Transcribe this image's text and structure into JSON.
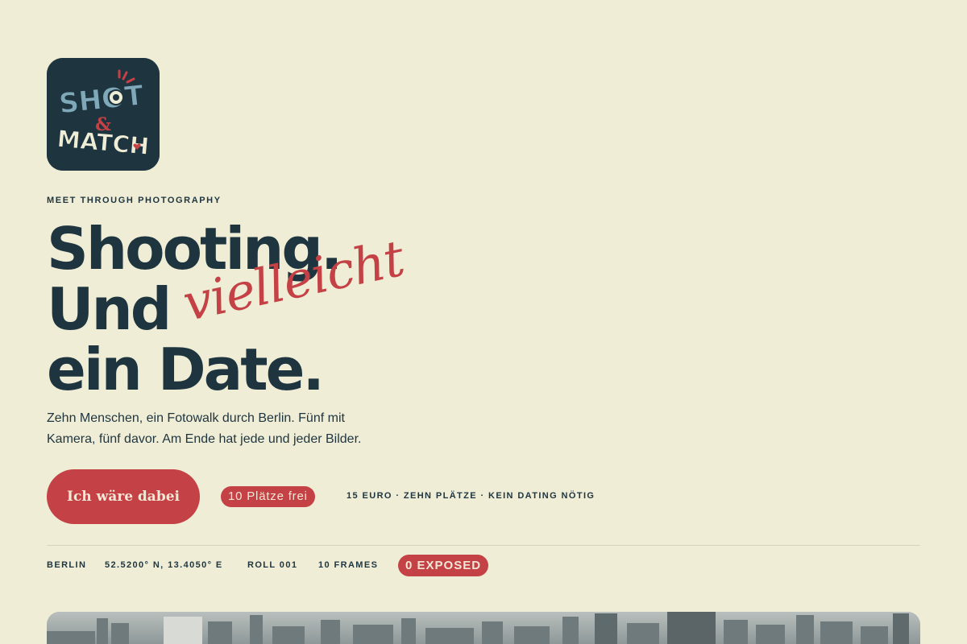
{
  "brand": {
    "logo_words": [
      "SHOT",
      "&",
      "MATCH"
    ],
    "colors": {
      "navy": "#1E3540",
      "red": "#C44145",
      "cream": "#F0EDD6",
      "light_blue": "#7FA9B8"
    }
  },
  "hero": {
    "tagline": "MEET THROUGH PHOTOGRAPHY",
    "headline_line1": "Shooting.",
    "headline_line2": "Und",
    "headline_script": "vielleicht",
    "headline_line3": "ein Date.",
    "lede": "Zehn Menschen, ein Fotowalk durch Berlin. Fünf mit Kamera, fünf davor. Am Ende hat jede und jeder Bilder."
  },
  "cta": {
    "button_label": "Ich wäre dabei",
    "seats_badge": "10 Plätze frei",
    "facts": "15 EURO · ZEHN PLÄTZE · KEIN DATING NÖTIG"
  },
  "meta": {
    "city": "BERLIN",
    "coordinates": "52.5200° N, 13.4050° E",
    "roll": "ROLL 001",
    "frames": "10 FRAMES",
    "exposed": "0 EXPOSED"
  },
  "photo": {
    "icon": "berlin-skyline-photo"
  }
}
